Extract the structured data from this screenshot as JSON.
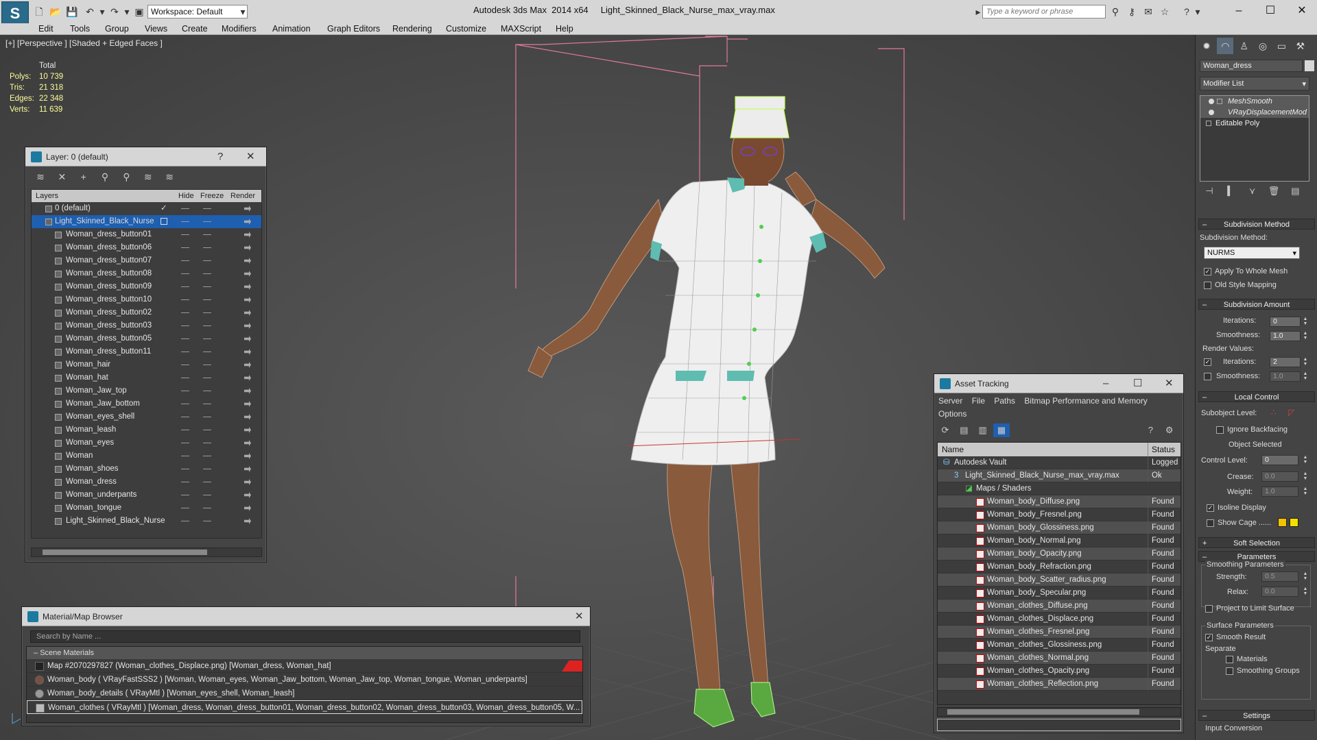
{
  "titlebar": {
    "workspace": "Workspace: Default",
    "app_name": "Autodesk 3ds Max  2014 x64",
    "file_name": "Light_Skinned_Black_Nurse_max_vray.max",
    "search_placeholder": "Type a keyword or phrase"
  },
  "menu": [
    "Edit",
    "Tools",
    "Group",
    "Views",
    "Create",
    "Modifiers",
    "Animation",
    "Graph Editors",
    "Rendering",
    "Customize",
    "MAXScript",
    "Help"
  ],
  "viewport": {
    "label": "[+] [Perspective ] [Shaded + Edged Faces ]",
    "stats": {
      "header": "Total",
      "polys_label": "Polys:",
      "polys": "10 739",
      "tris_label": "Tris:",
      "tris": "21 318",
      "edges_label": "Edges:",
      "edges": "22 348",
      "verts_label": "Verts:",
      "verts": "11 639"
    }
  },
  "layer_panel": {
    "title": "Layer: 0 (default)",
    "help": "?",
    "columns": [
      "Layers",
      "Hide",
      "Freeze",
      "Render"
    ],
    "layers": [
      {
        "name": "0 (default)",
        "level": 0
      },
      {
        "name": "Light_Skinned_Black_Nurse",
        "level": 0,
        "selected": true
      },
      {
        "name": "Woman_dress_button01",
        "level": 1
      },
      {
        "name": "Woman_dress_button06",
        "level": 1
      },
      {
        "name": "Woman_dress_button07",
        "level": 1
      },
      {
        "name": "Woman_dress_button08",
        "level": 1
      },
      {
        "name": "Woman_dress_button09",
        "level": 1
      },
      {
        "name": "Woman_dress_button10",
        "level": 1
      },
      {
        "name": "Woman_dress_button02",
        "level": 1
      },
      {
        "name": "Woman_dress_button03",
        "level": 1
      },
      {
        "name": "Woman_dress_button05",
        "level": 1
      },
      {
        "name": "Woman_dress_button11",
        "level": 1
      },
      {
        "name": "Woman_hair",
        "level": 1
      },
      {
        "name": "Woman_hat",
        "level": 1
      },
      {
        "name": "Woman_Jaw_top",
        "level": 1
      },
      {
        "name": "Woman_Jaw_bottom",
        "level": 1
      },
      {
        "name": "Woman_eyes_shell",
        "level": 1
      },
      {
        "name": "Woman_leash",
        "level": 1
      },
      {
        "name": "Woman_eyes",
        "level": 1
      },
      {
        "name": "Woman",
        "level": 1
      },
      {
        "name": "Woman_shoes",
        "level": 1
      },
      {
        "name": "Woman_dress",
        "level": 1
      },
      {
        "name": "Woman_underpants",
        "level": 1
      },
      {
        "name": "Woman_tongue",
        "level": 1
      },
      {
        "name": "Light_Skinned_Black_Nurse",
        "level": 1
      }
    ]
  },
  "material_browser": {
    "title": "Material/Map Browser",
    "search_placeholder": "Search by Name ...",
    "section": "Scene Materials",
    "items": [
      "Map #2070297827 (Woman_clothes_Displace.png)  [Woman_dress, Woman_hat]",
      "Woman_body  ( VRayFastSSS2 ) [Woman, Woman_eyes, Woman_Jaw_bottom, Woman_Jaw_top, Woman_tongue, Woman_underpants]",
      "Woman_body_details  ( VRayMtl ) [Woman_eyes_shell, Woman_leash]",
      "Woman_clothes  ( VRayMtl ) [Woman_dress, Woman_dress_button01, Woman_dress_button02, Woman_dress_button03, Woman_dress_button05, W..."
    ]
  },
  "asset_tracking": {
    "title": "Asset Tracking",
    "menu": [
      "Server",
      "File",
      "Paths",
      "Bitmap Performance and Memory",
      "Options"
    ],
    "columns": [
      "Name",
      "Status"
    ],
    "rows": [
      {
        "name": "Autodesk Vault",
        "status": "Logged O",
        "indent": 24,
        "kind": "vault"
      },
      {
        "name": "Light_Skinned_Black_Nurse_max_vray.max",
        "status": "Ok",
        "indent": 40,
        "kind": "max"
      },
      {
        "name": "Maps / Shaders",
        "status": "",
        "indent": 56,
        "kind": "maps"
      },
      {
        "name": "Woman_body_Diffuse.png",
        "status": "Found",
        "indent": 72,
        "kind": "png"
      },
      {
        "name": "Woman_body_Fresnel.png",
        "status": "Found",
        "indent": 72,
        "kind": "png"
      },
      {
        "name": "Woman_body_Glossiness.png",
        "status": "Found",
        "indent": 72,
        "kind": "png"
      },
      {
        "name": "Woman_body_Normal.png",
        "status": "Found",
        "indent": 72,
        "kind": "png"
      },
      {
        "name": "Woman_body_Opacity.png",
        "status": "Found",
        "indent": 72,
        "kind": "png"
      },
      {
        "name": "Woman_body_Refraction.png",
        "status": "Found",
        "indent": 72,
        "kind": "png"
      },
      {
        "name": "Woman_body_Scatter_radius.png",
        "status": "Found",
        "indent": 72,
        "kind": "png"
      },
      {
        "name": "Woman_body_Specular.png",
        "status": "Found",
        "indent": 72,
        "kind": "png"
      },
      {
        "name": "Woman_clothes_Diffuse.png",
        "status": "Found",
        "indent": 72,
        "kind": "png"
      },
      {
        "name": "Woman_clothes_Displace.png",
        "status": "Found",
        "indent": 72,
        "kind": "png"
      },
      {
        "name": "Woman_clothes_Fresnel.png",
        "status": "Found",
        "indent": 72,
        "kind": "png"
      },
      {
        "name": "Woman_clothes_Glossiness.png",
        "status": "Found",
        "indent": 72,
        "kind": "png"
      },
      {
        "name": "Woman_clothes_Normal.png",
        "status": "Found",
        "indent": 72,
        "kind": "png"
      },
      {
        "name": "Woman_clothes_Opacity.png",
        "status": "Found",
        "indent": 72,
        "kind": "png"
      },
      {
        "name": "Woman_clothes_Reflection.png",
        "status": "Found",
        "indent": 72,
        "kind": "png"
      }
    ]
  },
  "command_panel": {
    "object_name": "Woman_dress",
    "modifier_list": "Modifier List",
    "stack": [
      "MeshSmooth",
      "VRayDisplacementMod",
      "Editable Poly"
    ],
    "subdivision_method": {
      "header": "Subdivision Method",
      "label": "Subdivision Method:",
      "value": "NURMS",
      "apply_whole_mesh": "Apply To Whole Mesh",
      "old_style_mapping": "Old Style Mapping"
    },
    "subdivision_amount": {
      "header": "Subdivision Amount",
      "iterations_label": "Iterations:",
      "iterations": "0",
      "smoothness_label": "Smoothness:",
      "smoothness": "1.0",
      "render_values": "Render Values:",
      "r_iterations_label": "Iterations:",
      "r_iterations": "2",
      "r_smoothness_label": "Smoothness:",
      "r_smoothness": "1.0"
    },
    "local_control": {
      "header": "Local Control",
      "subobject_level": "Subobject Level:",
      "ignore_backfacing": "Ignore Backfacing",
      "object_selected": "Object Selected",
      "control_level_label": "Control Level:",
      "control_level": "0",
      "crease_label": "Crease:",
      "crease": "0.0",
      "weight_label": "Weight:",
      "weight": "1.0",
      "isoline_display": "Isoline Display",
      "show_cage": "Show Cage ......",
      "cage_color_1": "#f2c200",
      "cage_color_2": "#f5e000"
    },
    "soft_selection": {
      "header": "Soft Selection"
    },
    "parameters": {
      "header": "Parameters",
      "smoothing_params": "Smoothing Parameters",
      "strength_label": "Strength:",
      "strength": "0.5",
      "relax_label": "Relax:",
      "relax": "0.0",
      "project_limit": "Project to Limit Surface",
      "surface_params": "Surface Parameters",
      "smooth_result": "Smooth Result",
      "separate": "Separate",
      "materials": "Materials",
      "smoothing_groups": "Smoothing Groups"
    },
    "settings": {
      "header": "Settings",
      "input_conversion": "Input Conversion"
    }
  }
}
